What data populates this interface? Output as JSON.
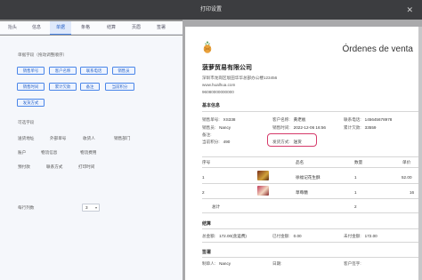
{
  "window": {
    "title": "打印设置",
    "close_icon": "close-icon"
  },
  "tabs": [
    {
      "label": "抬头"
    },
    {
      "label": "信息"
    },
    {
      "label": "单据"
    },
    {
      "label": "条格"
    },
    {
      "label": "结算"
    },
    {
      "label": "页眉"
    },
    {
      "label": "签署"
    }
  ],
  "left": {
    "section1_label": "单据字段（拖动调整顺序）",
    "selected_fields": [
      "销售单号",
      "客户名称",
      "联系电话",
      "销售员",
      "销售时间",
      "累计欠款",
      "备注",
      "当前积分",
      "发货方式"
    ],
    "section2_label": "可选字段",
    "optional_fields": [
      "送货地址",
      "外部单号",
      "收货人",
      "销售部门",
      "账户",
      "物流信息",
      "物流费用",
      "预付款",
      "联系方式",
      "打印时间"
    ],
    "columns_label": "每行列数",
    "columns_value": "3"
  },
  "paper": {
    "doc_title": "Órdenes de venta",
    "company": "菠萝贸易有限公司",
    "address": "深圳市龙岗区坂田华华总部办公楼123456",
    "website": "www.hualhua.com",
    "phone": "96080000000000",
    "basic_info_title": "基本信息",
    "basic": {
      "order_no_label": "销售单号:",
      "order_no": "XS338",
      "customer_label": "客户名称:",
      "customer": "黄老板",
      "tel_label": "联系电话:",
      "tel": "145645678978",
      "salesman_label": "销售员:",
      "salesman": "Nancy",
      "time_label": "销售时间:",
      "time": "2022-12-06 16:56",
      "debt_label": "累计欠款:",
      "debt": "33559",
      "remark_label": "备注:",
      "points_label": "当前积分:",
      "points": "490",
      "ship_label": "发货方式:",
      "ship": "送货"
    },
    "table": {
      "headers": {
        "no": "序号",
        "name": "品名",
        "qty": "数量",
        "price": "单价"
      },
      "rows": [
        {
          "no": "1",
          "name": "徐福记花生酥",
          "qty": "1",
          "price": "52.00"
        },
        {
          "no": "2",
          "name": "草莓糖",
          "qty": "1",
          "price": "16"
        }
      ],
      "total_label": "总计",
      "total_qty": "2"
    },
    "settle_title": "结算",
    "settle": {
      "total_label": "总金额:",
      "total": "172.00(含运费)",
      "paid_label": "已付金额:",
      "paid": "0.00",
      "unpaid_label": "未付金额:",
      "unpaid": "172.00"
    },
    "sign_title": "签署",
    "sign": {
      "maker_label": "制单人:",
      "maker": "Nancy",
      "date_label": "日期:",
      "customer_sign_label": "客户签字:"
    }
  },
  "colors": {
    "accent": "#4a86e8",
    "highlight": "#d63a6a"
  }
}
